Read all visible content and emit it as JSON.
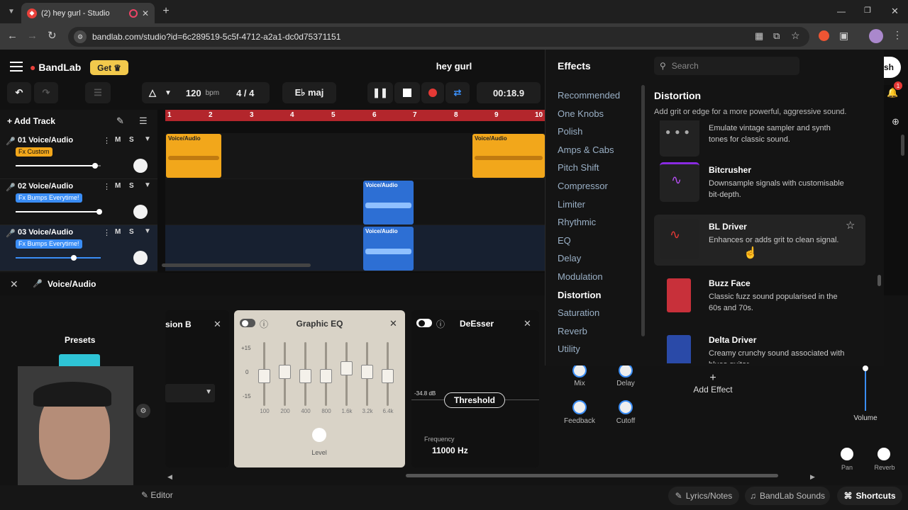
{
  "browser": {
    "tab_title": "(2) hey gurl - Studio",
    "url": "bandlab.com/studio?id=6c289519-5c5f-4712-a2a1-dc0d75371151"
  },
  "header": {
    "brand": "BandLab",
    "get_label": "Get",
    "project_title": "hey gurl"
  },
  "transport": {
    "bpm": "120",
    "bpm_unit": "bpm",
    "time_sig": "4 / 4",
    "key": "E♭ maj",
    "time": "00:18.9"
  },
  "tracks_header": {
    "add_track": "Add Track"
  },
  "timeline": {
    "bars": [
      "1",
      "2",
      "3",
      "4",
      "5",
      "6",
      "7",
      "8",
      "9",
      "10"
    ]
  },
  "tracks": [
    {
      "name": "01  Voice/Audio",
      "fx": "Fx Custom",
      "mute": "M",
      "solo": "S",
      "volume": 0.85
    },
    {
      "name": "02  Voice/Audio",
      "fx": "Fx Bumps Everytime!",
      "mute": "M",
      "solo": "S",
      "volume": 0.9
    },
    {
      "name": "03  Voice/Audio",
      "fx": "Fx Bumps Everytime!",
      "mute": "M",
      "solo": "S",
      "volume": 0.62
    }
  ],
  "clips": {
    "label": "Voice/Audio"
  },
  "fx_chain": {
    "track_label": "Voice/Audio",
    "presets_label": "Presets",
    "partial_title": "sion B",
    "eq_title": "Graphic EQ",
    "eq_scale": [
      "+15",
      "0",
      "-15"
    ],
    "eq_bands": [
      "100",
      "200",
      "400",
      "800",
      "1.6k",
      "3.2k",
      "6.4k"
    ],
    "eq_level": "Level",
    "deesser_title": "DeEsser",
    "deesser_db": "-34.8 dB",
    "threshold_label": "Threshold",
    "freq_label": "Frequency",
    "freq_value": "11000 Hz",
    "knobs": {
      "mix": "Mix",
      "delay": "Delay",
      "feedback": "Feedback",
      "cutoff": "Cutoff"
    },
    "add_effect": "Add Effect",
    "volume": "Volume",
    "pan": "Pan",
    "reverb": "Reverb"
  },
  "effects_browser": {
    "title": "Effects",
    "search_placeholder": "Search",
    "categories": [
      "Recommended",
      "One Knobs",
      "Polish",
      "Amps & Cabs",
      "Pitch Shift",
      "Compressor",
      "Limiter",
      "Rhythmic",
      "EQ",
      "Delay",
      "Modulation",
      "Distortion",
      "Saturation",
      "Reverb",
      "Utility"
    ],
    "active_category": "Distortion",
    "section_title": "Distortion",
    "section_desc": "Add grit or edge for a more powerful, aggressive sound.",
    "items": [
      {
        "name": "",
        "desc": "Emulate vintage sampler and synth tones for classic sound."
      },
      {
        "name": "Bitcrusher",
        "desc": "Downsample signals with customisable bit-depth."
      },
      {
        "name": "BL Driver",
        "desc": "Enhances or adds grit to clean signal."
      },
      {
        "name": "Buzz Face",
        "desc": "Classic fuzz sound popularised in the 60s and 70s."
      },
      {
        "name": "Delta Driver",
        "desc": "Creamy crunchy sound associated with blues guitar"
      }
    ]
  },
  "user": {
    "notifications": "1",
    "initial_fragment": "sh"
  },
  "statusbar": {
    "editor": "Editor",
    "lyrics": "Lyrics/Notes",
    "sounds": "BandLab Sounds",
    "shortcuts": "Shortcuts"
  },
  "colors": {
    "accent": "#3a8df5",
    "timeline": "#b3262c",
    "clip_orange": "#f2a71b",
    "clip_blue": "#2d6fd4",
    "brand_red": "#e8413b"
  }
}
